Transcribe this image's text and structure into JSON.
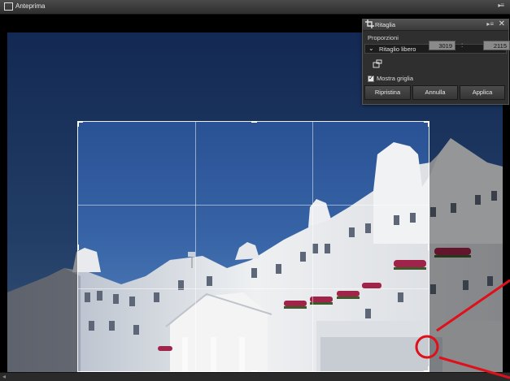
{
  "window": {
    "title": "Anteprima",
    "icon": "window-icon",
    "menu_icon": "panel-menu-icon"
  },
  "crop_panel": {
    "title": "Ritaglia",
    "section_label": "Proporzioni",
    "ratio_value": "Ritaglio libero",
    "width_value": "3019",
    "separator": ":",
    "height_value": "2115",
    "grid_checkbox": {
      "label": "Mostra griglia",
      "checked": true
    },
    "buttons": {
      "reset": "Ripristina",
      "cancel": "Annulla",
      "apply": "Applica"
    }
  },
  "colors": {
    "annotation": "#e0101a",
    "panel_bg": "#2f2f2f",
    "sky": "#2e5597"
  }
}
